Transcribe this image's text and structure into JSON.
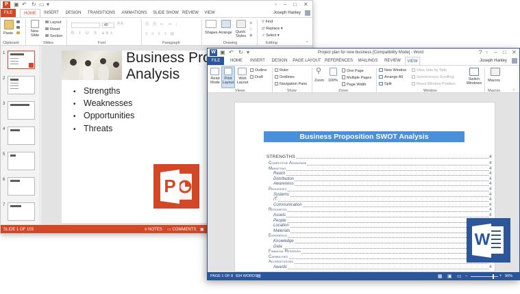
{
  "powerpoint": {
    "title": "",
    "account_name": "Joseph Hanley",
    "tabs": [
      {
        "label": "FILE"
      },
      {
        "label": "HOME"
      },
      {
        "label": "INSERT"
      },
      {
        "label": "DESIGN"
      },
      {
        "label": "TRANSITIONS"
      },
      {
        "label": "ANIMATIONS"
      },
      {
        "label": "SLIDE SHOW"
      },
      {
        "label": "REVIEW"
      },
      {
        "label": "VIEW"
      }
    ],
    "ribbon": {
      "paste_label": "Paste",
      "new_slide_label": "New Slide",
      "layout_label": "Layout",
      "reset_label": "Reset",
      "section_label": "Section",
      "font_size": "40",
      "shapes_label": "Shapes",
      "arrange_label": "Arrange",
      "quick_styles_label": "Quick Styles",
      "find_label": "Find",
      "replace_label": "Replace",
      "select_label": "Select",
      "groups": [
        "Clipboard",
        "Slides",
        "Font",
        "Paragraph",
        "Drawing",
        "Editing"
      ]
    },
    "thumbnails": [
      "1",
      "2",
      "3",
      "4",
      "5",
      "6",
      "7"
    ],
    "slide": {
      "title": "Business Proposition\nAnalysis",
      "bullets": [
        "Strengths",
        "Weaknesses",
        "Opportunities",
        "Threats"
      ]
    },
    "status": {
      "slide_info": "SLIDE 1 OF 103",
      "notes_label": "NOTES",
      "comments_label": "COMMENTS"
    },
    "logo_letter": "P",
    "colors": {
      "accent": "#d24726"
    }
  },
  "word": {
    "title": "Project plan for new business [Compatibility Mode] - Word",
    "account_name": "Joseph Hanley",
    "tabs": [
      {
        "label": "FILE"
      },
      {
        "label": "HOME"
      },
      {
        "label": "INSERT"
      },
      {
        "label": "DESIGN"
      },
      {
        "label": "PAGE LAYOUT"
      },
      {
        "label": "REFERENCES"
      },
      {
        "label": "MAILINGS"
      },
      {
        "label": "REVIEW"
      },
      {
        "label": "VIEW"
      }
    ],
    "ribbon": {
      "read_mode": "Read Mode",
      "print_layout": "Print Layout",
      "web_layout": "Web Layout",
      "outline": "Outline",
      "draft": "Draft",
      "ruler": "Ruler",
      "gridlines": "Gridlines",
      "navigation_pane": "Navigation Pane",
      "zoom": "Zoom",
      "hundred": "100%",
      "one_page": "One Page",
      "multiple_pages": "Multiple Pages",
      "page_width": "Page Width",
      "new_window": "New Window",
      "arrange_all": "Arrange All",
      "split": "Split",
      "view_side_by_side": "View Side by Side",
      "synchronous_scrolling": "Synchronous Scrolling",
      "reset_window_position": "Reset Window Position",
      "switch_windows": "Switch Windows",
      "macros": "Macros",
      "groups": [
        "Views",
        "Show",
        "Zoom",
        "Window",
        "Macros"
      ]
    },
    "document": {
      "heading": "Business Proposition SWOT Analysis",
      "toc": [
        {
          "text": "STRENGTHS",
          "level": 0,
          "page": "4"
        },
        {
          "text": "Competitive Advantage",
          "level": 1,
          "page": "4"
        },
        {
          "text": "Marketing",
          "level": 1,
          "page": "4"
        },
        {
          "text": "Reach",
          "level": 2,
          "page": "4"
        },
        {
          "text": "Distribution",
          "level": 2,
          "page": "4"
        },
        {
          "text": "Awareness",
          "level": 2,
          "page": "4"
        },
        {
          "text": "Processes",
          "level": 1,
          "page": "4"
        },
        {
          "text": "Systems",
          "level": 2,
          "page": "4"
        },
        {
          "text": "IT",
          "level": 2,
          "page": "4"
        },
        {
          "text": "Communication",
          "level": 2,
          "page": "4"
        },
        {
          "text": "Resources",
          "level": 1,
          "page": "4"
        },
        {
          "text": "Assets",
          "level": 2,
          "page": "4"
        },
        {
          "text": "People",
          "level": 2,
          "page": "4"
        },
        {
          "text": "Location",
          "level": 2,
          "page": "4"
        },
        {
          "text": "Materials",
          "level": 2,
          "page": "4"
        },
        {
          "text": "Experience",
          "level": 1,
          "page": "4"
        },
        {
          "text": "Knowledge",
          "level": 2,
          "page": "4"
        },
        {
          "text": "Data",
          "level": 2,
          "page": "4"
        },
        {
          "text": "Financial Reserves",
          "level": 1,
          "page": "4"
        },
        {
          "text": "Capabilities",
          "level": 1,
          "page": "4"
        },
        {
          "text": "Accreditations",
          "level": 1,
          "page": "4"
        },
        {
          "text": "Awards",
          "level": 2,
          "page": "4"
        }
      ]
    },
    "status": {
      "page_info": "PAGE 1 OF 8",
      "word_count": "834 WORDS",
      "zoom": "90%"
    },
    "logo_letter": "W",
    "colors": {
      "accent": "#2b579a"
    }
  }
}
